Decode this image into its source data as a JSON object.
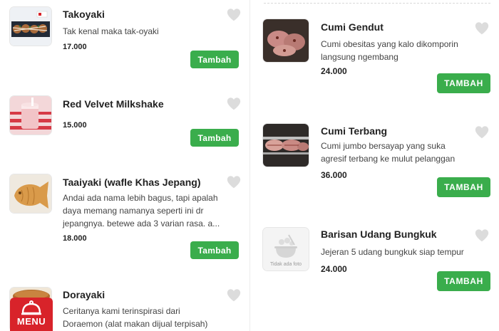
{
  "left_items": [
    {
      "name": "Takoyaki",
      "description": "Tak kenal maka tak-oyaki",
      "price": "17.000",
      "button": "Tambah",
      "image": "takoyaki-photo"
    },
    {
      "name": "Red Velvet Milkshake",
      "description": "",
      "price": "15.000",
      "button": "Tambah",
      "image": "milkshake-photo"
    },
    {
      "name": "Taaiyaki (wafle Khas Jepang)",
      "description": "Andai ada nama lebih bagus, tapi apalah daya memang namanya seperti ini dr jepangnya. betewe ada 3 varian rasa. a...",
      "price": "18.000",
      "button": "Tambah",
      "image": "taiyaki-photo"
    },
    {
      "name": "Dorayaki",
      "description": "Ceritanya kami terinspirasi dari Doraemon (alat makan dijual terpisah)",
      "price": "",
      "button": "",
      "image": "dorayaki-photo"
    }
  ],
  "right_items": [
    {
      "name": "Cumi Gendut",
      "description": "Cumi obesitas yang kalo dikomporin langsung ngembang",
      "price": "24.000",
      "button": "TAMBAH",
      "image": "cumi-gendut-photo"
    },
    {
      "name": "Cumi Terbang",
      "description": "Cumi jumbo bersayap yang suka agresif terbang ke mulut pelanggan",
      "price": "36.000",
      "button": "TAMBAH",
      "image": "cumi-terbang-photo"
    },
    {
      "name": "Barisan Udang Bungkuk",
      "description": "Jejeran 5 udang bungkuk siap tempur",
      "price": "24.000",
      "button": "TAMBAH",
      "image": "placeholder",
      "placeholder_caption": "Tidak ada foto"
    }
  ],
  "menu_badge": {
    "label": "MENU",
    "icon": "cloche-icon"
  },
  "colors": {
    "accent_green": "#3aad4c",
    "heart_gray": "#dcdcdc",
    "menu_red": "#d8232a"
  }
}
